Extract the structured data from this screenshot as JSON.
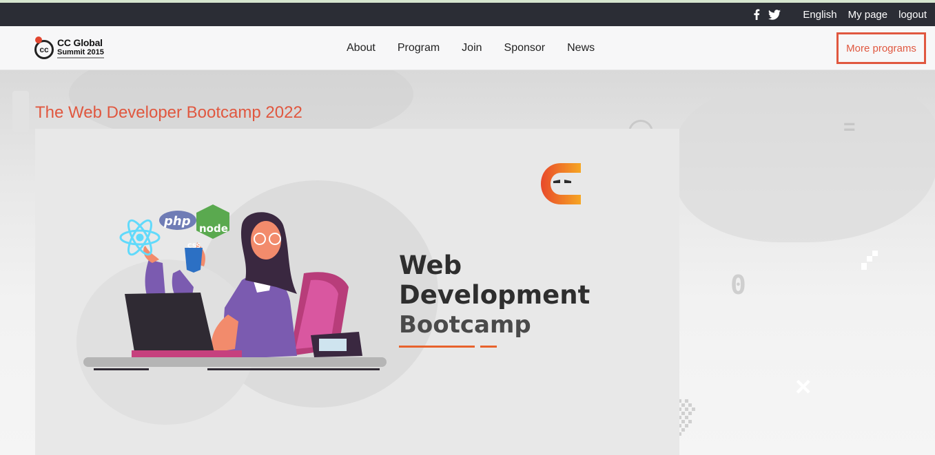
{
  "topbar": {
    "icons": [
      "facebook-icon",
      "twitter-icon"
    ],
    "links": [
      "English",
      "My page",
      "logout"
    ]
  },
  "navbar": {
    "logo": {
      "line1": "CC Global",
      "line2": "Summit 2015",
      "mark": "cc"
    },
    "links": [
      "About",
      "Program",
      "Join",
      "Sponsor",
      "News"
    ],
    "more_button": "More programs"
  },
  "main": {
    "title": "The Web Developer Bootcamp 2022",
    "banner": {
      "heading_line1": "Web",
      "heading_line2": "Development",
      "heading_line3": "Bootcamp",
      "tech_badges": [
        "php",
        "node",
        "CSS"
      ],
      "background_glyph": "0"
    }
  },
  "colors": {
    "accent": "#e0573f",
    "topbar_bg": "#2b2d35",
    "navbar_bg": "#f7f7f8",
    "logo_orange": "#f08a22"
  }
}
